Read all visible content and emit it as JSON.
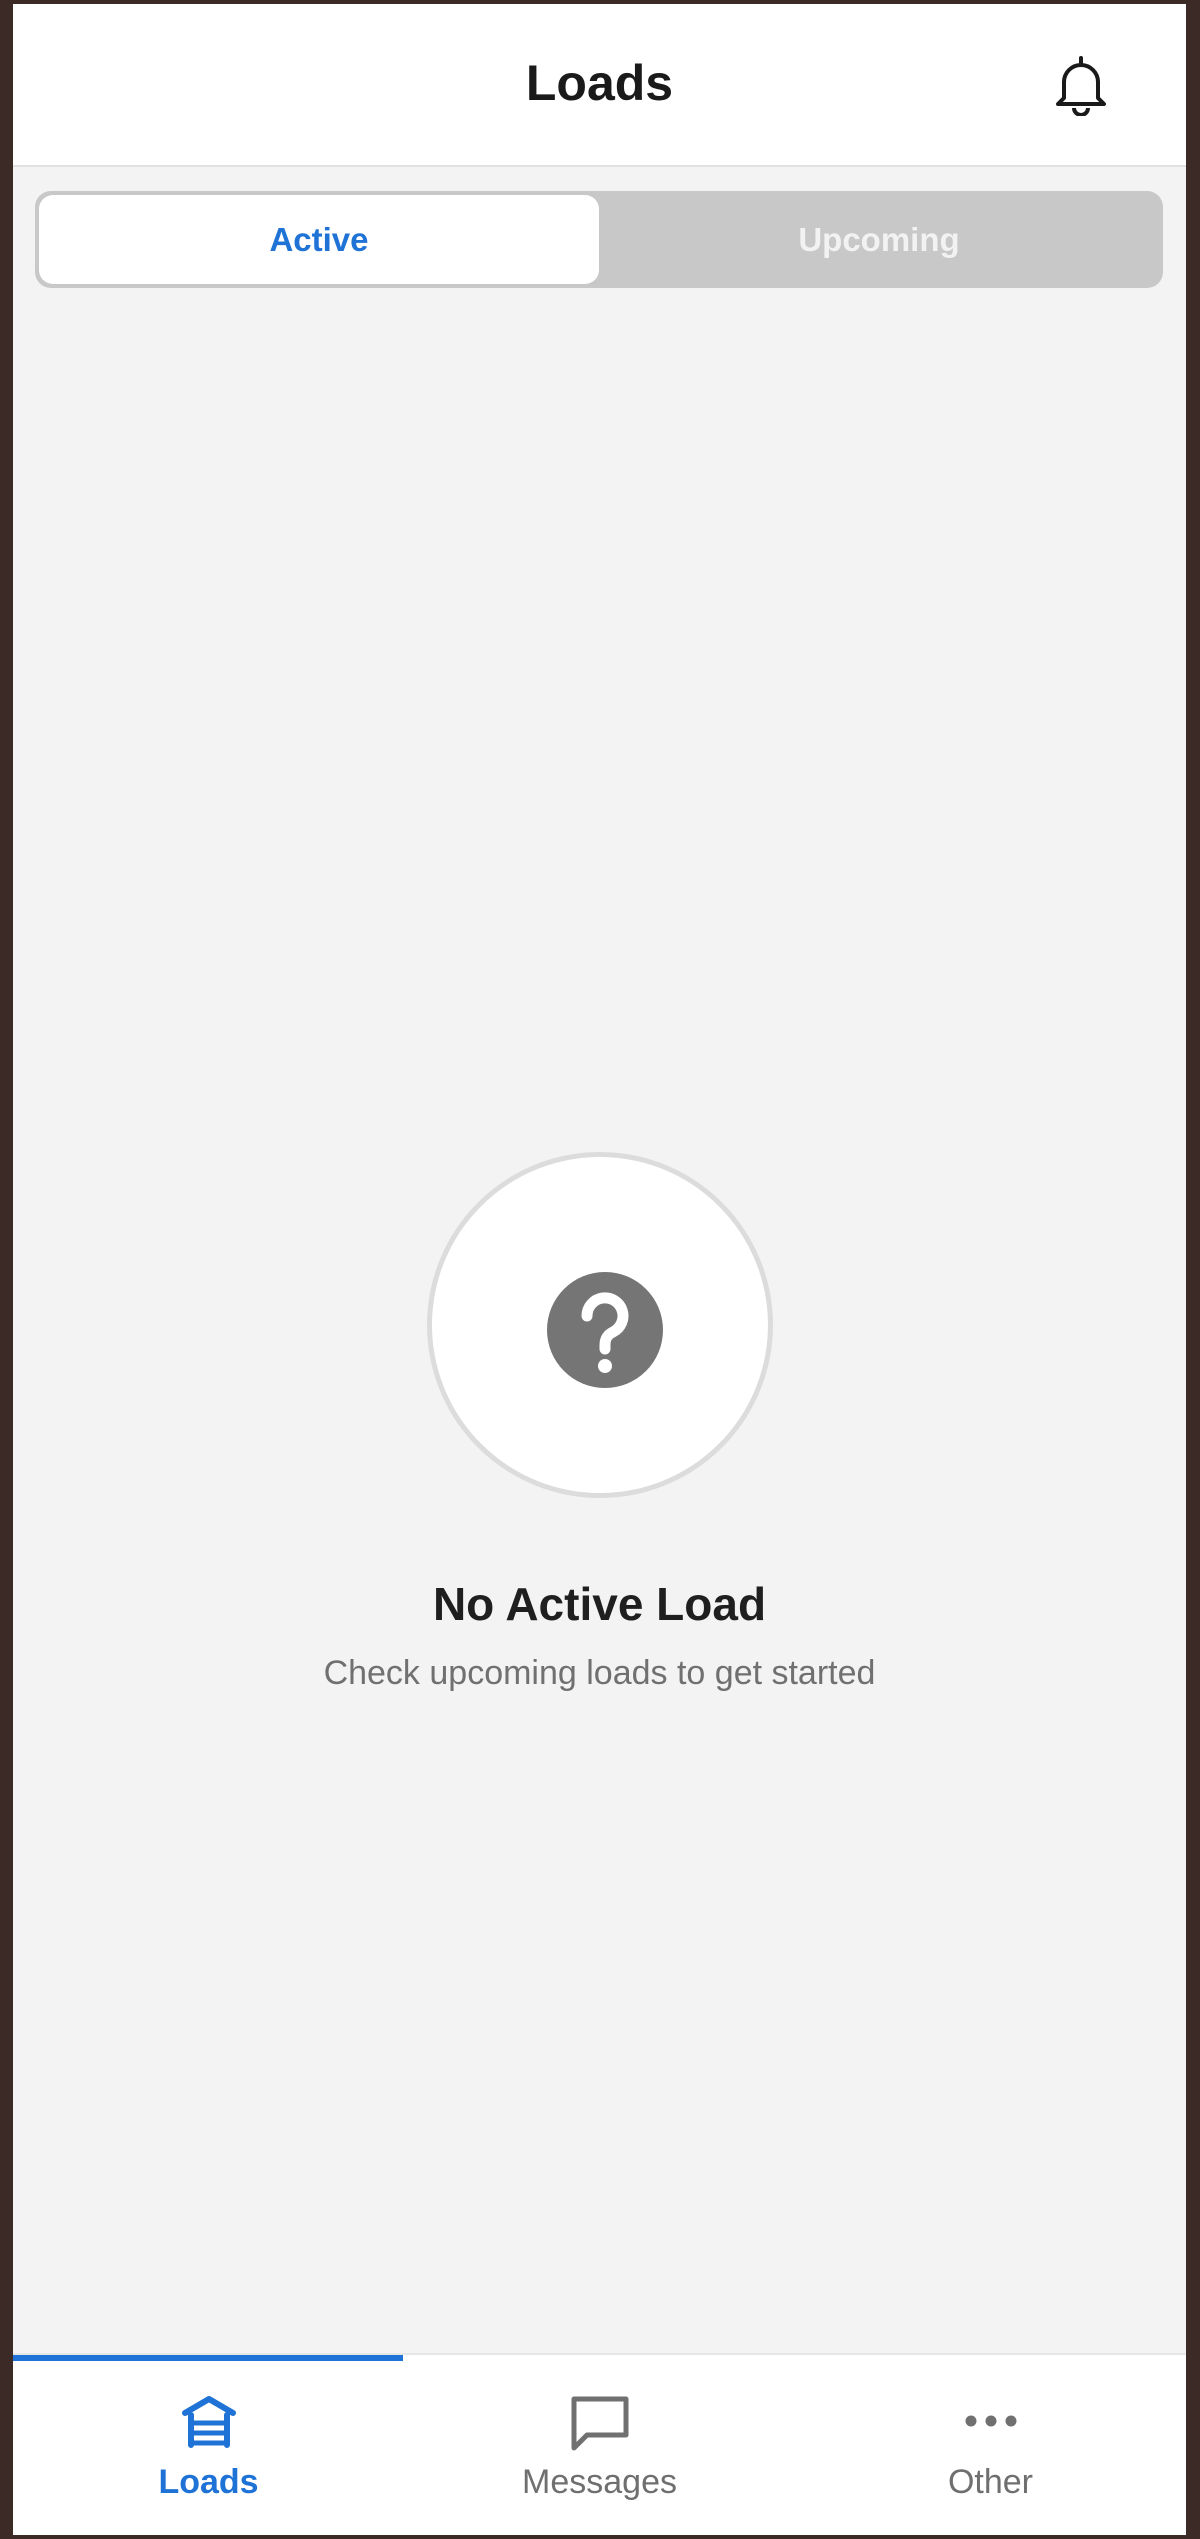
{
  "header": {
    "title": "Loads"
  },
  "tabs_segment": {
    "active_label": "Active",
    "upcoming_label": "Upcoming"
  },
  "empty_state": {
    "title": "No Active Load",
    "subtitle": "Check upcoming loads to get started"
  },
  "bottom_nav": {
    "items": [
      {
        "label": "Loads",
        "icon": "warehouse-icon",
        "selected": true
      },
      {
        "label": "Messages",
        "icon": "chat-bubble-icon",
        "selected": false
      },
      {
        "label": "Other",
        "icon": "more-horizontal-icon",
        "selected": false
      }
    ]
  },
  "colors": {
    "accent": "#1f73d6",
    "background": "#f3f3f3",
    "segment_inactive": "#c8c8c8"
  }
}
